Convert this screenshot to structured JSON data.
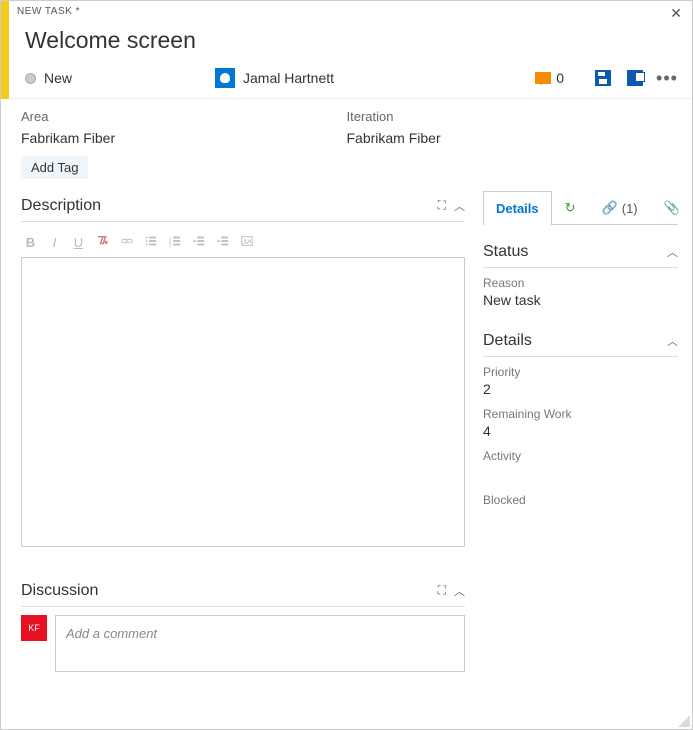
{
  "header": {
    "type_label": "NEW TASK *",
    "title": "Welcome screen"
  },
  "meta": {
    "state": "New",
    "assignee": "Jamal Hartnett",
    "comment_count": "0"
  },
  "classification": {
    "area_label": "Area",
    "area_value": "Fabrikam Fiber",
    "iteration_label": "Iteration",
    "iteration_value": "Fabrikam Fiber"
  },
  "tags": {
    "add_label": "Add Tag"
  },
  "left": {
    "description_heading": "Description",
    "discussion_heading": "Discussion",
    "discussion_placeholder": "Add a comment",
    "disc_avatar_initials": "KF"
  },
  "tabs": {
    "details": "Details",
    "links_count": "(1)"
  },
  "right": {
    "status_heading": "Status",
    "reason_label": "Reason",
    "reason_value": "New task",
    "details_heading": "Details",
    "priority_label": "Priority",
    "priority_value": "2",
    "remaining_label": "Remaining Work",
    "remaining_value": "4",
    "activity_label": "Activity",
    "blocked_label": "Blocked"
  }
}
